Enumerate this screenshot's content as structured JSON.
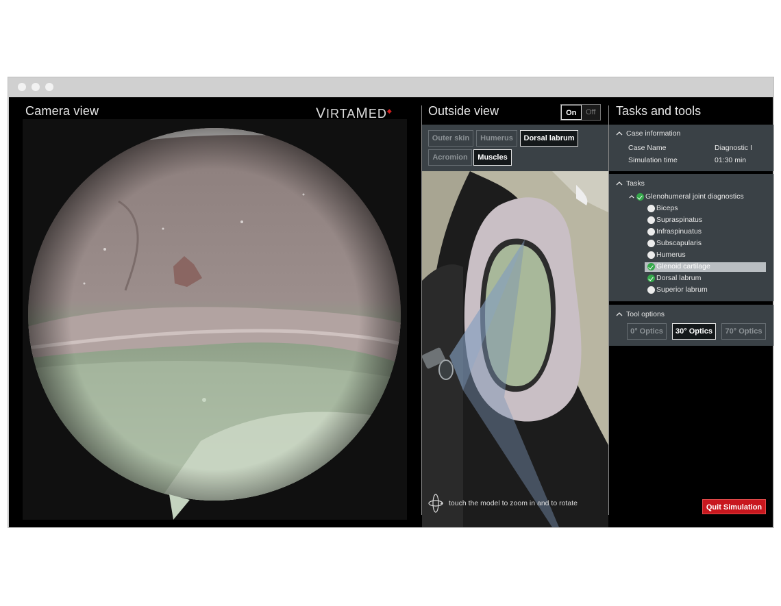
{
  "camera": {
    "title": "Camera view"
  },
  "logo": {
    "prefix_large": "V",
    "prefix": "IRTA",
    "mid_large": "M",
    "suffix": "ED"
  },
  "outside": {
    "title": "Outside view",
    "toggle": {
      "on": "On",
      "off": "Off",
      "selected": "On"
    },
    "layers": [
      {
        "label": "Outer skin",
        "active": false
      },
      {
        "label": "Humerus",
        "active": false
      },
      {
        "label": "Dorsal labrum",
        "active": true
      },
      {
        "label": "Acromion",
        "active": false
      },
      {
        "label": "Muscles",
        "active": true
      }
    ],
    "hint": "touch the model to zoom in and to rotate"
  },
  "tasks_tools": {
    "title": "Tasks and tools",
    "case_information": {
      "header": "Case information",
      "rows": [
        {
          "label": "Case Name",
          "value": "Diagnostic I"
        },
        {
          "label": "Simulation time",
          "value": "01:30 min"
        }
      ]
    },
    "tasks": {
      "header": "Tasks",
      "group": {
        "label": "Glenohumeral joint diagnostics",
        "done": true
      },
      "items": [
        {
          "label": "Biceps",
          "done": false,
          "selected": false
        },
        {
          "label": "Supraspinatus",
          "done": false,
          "selected": false
        },
        {
          "label": "Infraspinuatus",
          "done": false,
          "selected": false
        },
        {
          "label": "Subscapularis",
          "done": false,
          "selected": false
        },
        {
          "label": "Humerus",
          "done": false,
          "selected": false
        },
        {
          "label": "Glenoid cartilage",
          "done": true,
          "selected": true
        },
        {
          "label": "Dorsal labrum",
          "done": true,
          "selected": false
        },
        {
          "label": "Superior labrum",
          "done": false,
          "selected": false
        }
      ]
    },
    "tool_options": {
      "header": "Tool options",
      "options": [
        {
          "label": "0° Optics",
          "active": false
        },
        {
          "label": "30° Optics",
          "active": true
        },
        {
          "label": "70° Optics",
          "active": false
        }
      ]
    },
    "quit_label": "Quit Simulation"
  },
  "colors": {
    "panel": "#3a4146",
    "accent_red": "#c8171e",
    "check_green": "#34a84a"
  }
}
